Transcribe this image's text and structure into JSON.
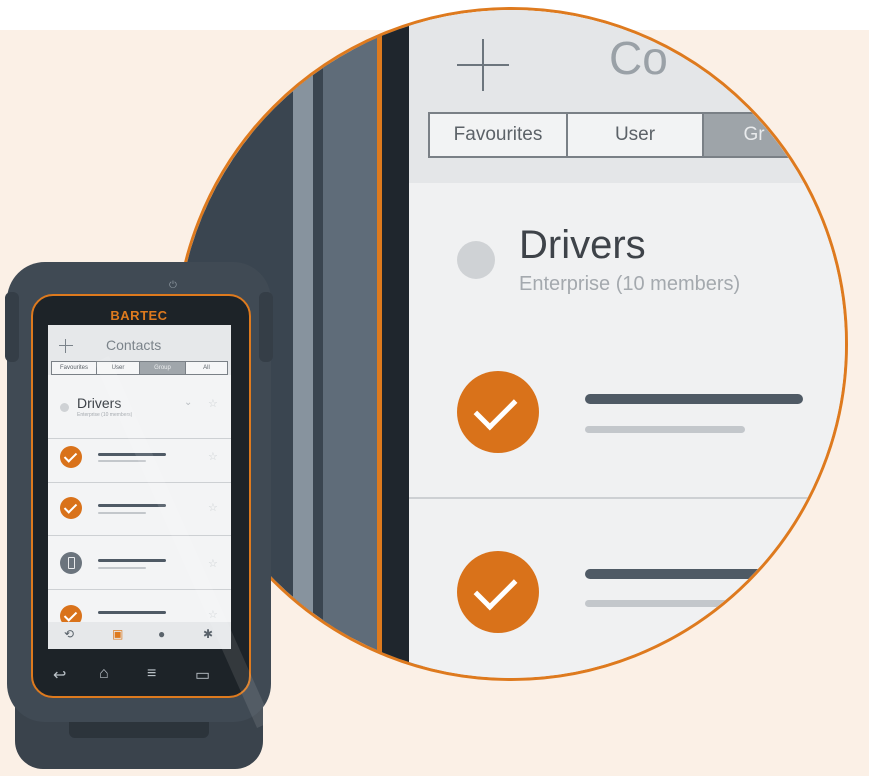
{
  "brand": "BARTEC",
  "colors": {
    "accent": "#de7a1e",
    "background": "#fbf0e6",
    "frame": "#404a54"
  },
  "screen": {
    "title": "Contacts",
    "add_icon": "plus-icon",
    "tabs": [
      "Favourites",
      "User",
      "Group",
      "All"
    ],
    "active_tab": "Group",
    "group": {
      "name": "Drivers",
      "subtitle": "Enterprise (10 members)"
    },
    "bottom_bar": [
      "history-icon",
      "contacts-icon",
      "location-icon",
      "settings-icon"
    ],
    "nav_bar": [
      "back-icon",
      "home-icon",
      "menu-icon",
      "recent-apps-icon"
    ]
  },
  "zoom": {
    "title_partial": "Co",
    "tabs": [
      "Favourites",
      "User",
      "Gr"
    ],
    "group": {
      "name": "Drivers",
      "subtitle": "Enterprise (10 members)"
    }
  }
}
